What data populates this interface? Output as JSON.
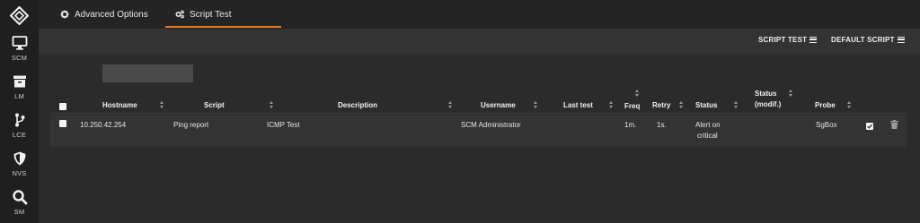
{
  "sidebar": {
    "items": [
      {
        "label": "SCM",
        "icon": "monitor-icon"
      },
      {
        "label": "LM",
        "icon": "archive-icon"
      },
      {
        "label": "LCE",
        "icon": "branch-icon"
      },
      {
        "label": "NVS",
        "icon": "shield-icon"
      },
      {
        "label": "SM",
        "icon": "search-icon"
      }
    ]
  },
  "tabs": [
    {
      "label": "Advanced Options",
      "icon": "gear-icon"
    },
    {
      "label": "Script Test",
      "icon": "gears-icon",
      "active": true
    }
  ],
  "toolbar": {
    "script_test_label": "SCRIPT TEST",
    "default_script_label": "DEFAULT SCRIPT"
  },
  "table": {
    "columns": {
      "hostname": "Hostname",
      "script": "Script",
      "description": "Description",
      "username": "Username",
      "last_test": "Last test",
      "freq": "Freq",
      "retry": "Retry",
      "status": "Status",
      "status_modif_1": "Status",
      "status_modif_2": "(modif.)",
      "probe": "Probe"
    },
    "rows": [
      {
        "hostname": "10.250.42.254",
        "script": "Ping report",
        "description": "ICMP Test",
        "username": "SCM Administrator",
        "last_test": "",
        "freq": "1m.",
        "retry": "1s.",
        "status_line1": "Alert on",
        "status_line2": "critical",
        "status_modif": "",
        "probe": "SgBox",
        "enabled": true
      }
    ]
  },
  "colors": {
    "accent": "#e07b1f",
    "sidebar_bg": "#1f1f1f",
    "toolbar_bg": "#333333",
    "content_bg": "#2b2b2b"
  }
}
